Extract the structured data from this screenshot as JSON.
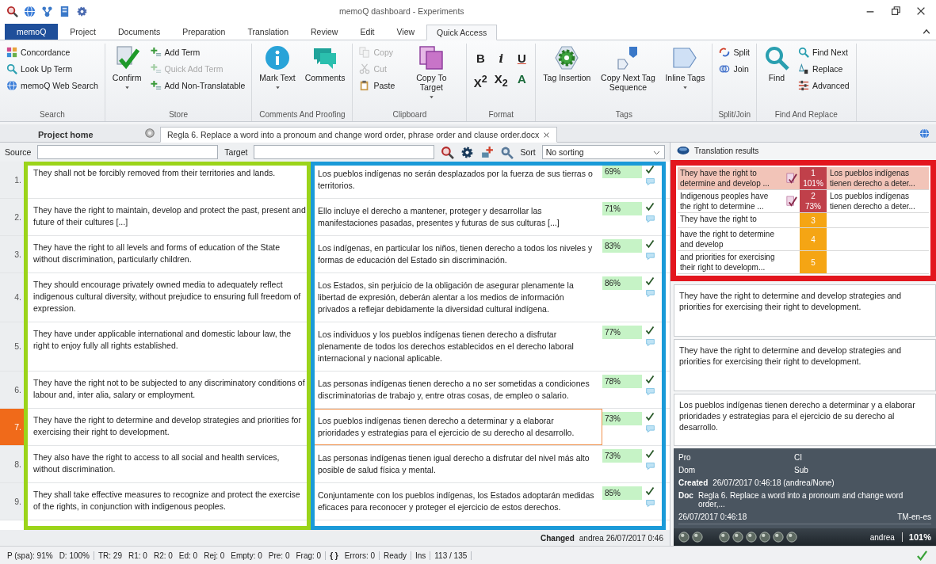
{
  "window": {
    "title": "memoQ dashboard - Experiments"
  },
  "ribbon_tabs": [
    {
      "label": "memoQ",
      "kind": "app",
      "selected": false
    },
    {
      "label": "Project",
      "kind": "tab",
      "selected": false
    },
    {
      "label": "Documents",
      "kind": "tab",
      "selected": false
    },
    {
      "label": "Preparation",
      "kind": "tab",
      "selected": false
    },
    {
      "label": "Translation",
      "kind": "tab",
      "selected": false
    },
    {
      "label": "Review",
      "kind": "tab",
      "selected": false
    },
    {
      "label": "Edit",
      "kind": "tab",
      "selected": false
    },
    {
      "label": "View",
      "kind": "tab",
      "selected": false
    },
    {
      "label": "Quick Access",
      "kind": "tab",
      "selected": true
    }
  ],
  "ribbon": {
    "groups": [
      {
        "label": "Search",
        "items": [
          {
            "label": "Concordance",
            "kind": "small",
            "disabled": false
          },
          {
            "label": "Look Up Term",
            "kind": "small",
            "disabled": false
          },
          {
            "label": "memoQ Web Search",
            "kind": "small",
            "disabled": false
          }
        ]
      },
      {
        "label": "Store",
        "items": [
          {
            "label": "Confirm",
            "kind": "large",
            "dropdown": true
          },
          {
            "label": "Add Term",
            "kind": "small",
            "disabled": false
          },
          {
            "label": "Quick Add Term",
            "kind": "small",
            "disabled": true
          },
          {
            "label": "Add Non-Translatable",
            "kind": "small",
            "disabled": false
          }
        ]
      },
      {
        "label": "Comments And Proofing",
        "items": [
          {
            "label": "Mark Text",
            "kind": "large",
            "dropdown": true
          },
          {
            "label": "Comments",
            "kind": "large",
            "dropdown": false
          }
        ]
      },
      {
        "label": "Clipboard",
        "items": [
          {
            "label": "Copy",
            "kind": "small",
            "disabled": true
          },
          {
            "label": "Cut",
            "kind": "small",
            "disabled": true
          },
          {
            "label": "Paste",
            "kind": "small",
            "disabled": false
          },
          {
            "label": "Copy To Target",
            "kind": "large",
            "dropdown": true
          }
        ]
      },
      {
        "label": "Format",
        "items": [
          {
            "label": "B",
            "kind": "glyph"
          },
          {
            "label": "i",
            "kind": "glyph"
          },
          {
            "label": "U",
            "kind": "glyph"
          },
          {
            "label": "X$^{2}$",
            "kind": "glyph"
          },
          {
            "label": "X$_{2}$",
            "kind": "glyph"
          },
          {
            "label": "A",
            "kind": "glyph"
          }
        ]
      },
      {
        "label": "Tags",
        "items": [
          {
            "label": "Tag Insertion",
            "kind": "large",
            "dropdown": false
          },
          {
            "label": "Copy Next Tag Sequence",
            "kind": "large",
            "dropdown": false
          },
          {
            "label": "Inline Tags",
            "kind": "large",
            "dropdown": true
          }
        ]
      },
      {
        "label": "Split/Join",
        "items": [
          {
            "label": "Split",
            "kind": "small",
            "disabled": false
          },
          {
            "label": "Join",
            "kind": "small",
            "disabled": false
          }
        ]
      },
      {
        "label": "Find And Replace",
        "items": [
          {
            "label": "Find",
            "kind": "large",
            "dropdown": false
          },
          {
            "label": "Find Next",
            "kind": "small",
            "disabled": false
          },
          {
            "label": "Replace",
            "kind": "small",
            "disabled": false
          },
          {
            "label": "Advanced",
            "kind": "small",
            "disabled": false
          }
        ]
      }
    ]
  },
  "doc_tabs": [
    {
      "label": "Project home",
      "selected": false,
      "closable": false
    },
    {
      "label": "Regla 6. Replace a word into a pronoum and change word order, phrase order and clause order.docx",
      "selected": true,
      "closable": true
    }
  ],
  "filter": {
    "source_label": "Source",
    "target_label": "Target",
    "sort_label": "Sort",
    "sort_value": "No sorting"
  },
  "segments": [
    {
      "number": "1.",
      "source": "They shall not be forcibly removed from their territories and lands.",
      "target": "Los pueblos indígenas no serán desplazados por la fuerza de sus tierras o territorios.",
      "match": "69%",
      "confirmed": true,
      "selected": false
    },
    {
      "number": "2.",
      "source": "They have the right to maintain, develop and protect the past, present and future of their cultures [...]",
      "target": "Ello incluye el derecho a mantener, proteger y desarrollar las manifestaciones pasadas, presentes y futuras de sus culturas [...]",
      "match": "71%",
      "confirmed": true,
      "selected": false
    },
    {
      "number": "3.",
      "source": "They have the right to all levels and forms of education of the State without discrimination, particularly children.",
      "target": "Los indígenas, en particular los niños, tienen derecho a todos los niveles y formas de educación del Estado sin discriminación.",
      "match": "83%",
      "confirmed": true,
      "selected": false
    },
    {
      "number": "4.",
      "source": "They should encourage privately owned media to adequately reflect indigenous cultural diversity, without prejudice to ensuring full freedom of expression.",
      "target": "Los Estados, sin perjuicio de la obligación de asegurar plenamente la libertad de expresión, deberán alentar a los medios de información privados a reflejar debidamente la diversidad cultural indígena.",
      "match": "86%",
      "confirmed": true,
      "selected": false
    },
    {
      "number": "5.",
      "source": "They have under applicable international and domestic labour law, the right to enjoy fully all rights established.",
      "target": "Los individuos y los pueblos indígenas tienen derecho a disfrutar plenamente de todos los derechos establecidos en el derecho laboral internacional y nacional aplicable.",
      "match": "77%",
      "confirmed": true,
      "selected": false
    },
    {
      "number": "6.",
      "source": "They have the right not to be subjected to any discriminatory conditions of labour and, inter alia, salary or employment.",
      "target": "Las personas indígenas tienen derecho a no ser sometidas a condiciones discriminatorias de trabajo y, entre otras cosas, de empleo o salario.",
      "match": "78%",
      "confirmed": true,
      "selected": false
    },
    {
      "number": "7.",
      "source": "They have the right to determine and develop strategies and priorities for exercising their right to development.",
      "target": "Los pueblos indígenas tienen derecho a determinar y a elaborar prioridades y estrategias para el ejercicio de su derecho al desarrollo.",
      "match": "73%",
      "confirmed": true,
      "selected": true
    },
    {
      "number": "8.",
      "source": "They also have the right to access to all social and health services, without discrimination.",
      "target": "Las personas indígenas tienen igual derecho a disfrutar del nivel más alto posible de salud física y mental.",
      "match": "73%",
      "confirmed": true,
      "selected": false
    },
    {
      "number": "9.",
      "source": "They shall take effective measures to recognize and protect the exercise of the rights, in conjunction with indigenous peoples.",
      "target": "Conjuntamente con los pueblos indígenas, los Estados adoptarán medidas eficaces para reconocer y proteger el ejercicio de estos derechos.",
      "match": "85%",
      "confirmed": true,
      "selected": false
    }
  ],
  "editor_footer": {
    "label": "Changed",
    "value": "andrea 26/07/2017 0:46"
  },
  "translation_results": {
    "title": "Translation results",
    "rows": [
      {
        "kind": "tm",
        "source": "They have the right to determine and develop ...",
        "rank": "1",
        "percent": "101%",
        "target": "Los pueblos indígenas tienen derecho a deter...",
        "selected": true
      },
      {
        "kind": "tm",
        "source": "Indigenous peoples have the right to determine ...",
        "rank": "2",
        "percent": "73%",
        "target": "Los pueblos indígenas tienen derecho a deter...",
        "selected": false
      },
      {
        "kind": "fragment",
        "source": "They have the right to",
        "rank": "3",
        "selected": false
      },
      {
        "kind": "fragment",
        "source": "have the right to determine and develop",
        "rank": "4",
        "selected": false
      },
      {
        "kind": "fragment",
        "source": "and priorities for exercising their right to developm...",
        "rank": "5",
        "selected": false
      }
    ]
  },
  "compare_panes": [
    "They have the right to determine and develop strategies and priorities for exercising their right to development.",
    "They have the right to determine and develop strategies and priorities for exercising their right to development.",
    "Los pueblos indígenas tienen derecho a determinar y a elaborar prioridades y estrategias para el ejercicio de su derecho al desarrollo."
  ],
  "meta": {
    "pro": "Pro",
    "ci": "CI",
    "dom": "Dom",
    "sub": "Sub",
    "created_label": "Created",
    "created": "26/07/2017 0:46:18 (andrea/None)",
    "doc_label": "Doc",
    "doc": "Regla 6. Replace a word into a pronoum and change word order,...",
    "date": "26/07/2017 0:46:18",
    "tm": "TM-en-es",
    "user": "andrea",
    "match": "101%"
  },
  "status_bar": [
    [
      "P (spa): 91%",
      "D: 100%"
    ],
    [
      "TR: 29",
      "R1: 0",
      "R2: 0",
      "Ed: 0",
      "Rej: 0",
      "Empty: 0",
      "Pre: 0",
      "Frag: 0"
    ],
    [
      "{ }",
      "Errors: 0"
    ],
    [
      "Ready"
    ],
    [
      "Ins"
    ],
    [
      "113 / 135"
    ]
  ]
}
